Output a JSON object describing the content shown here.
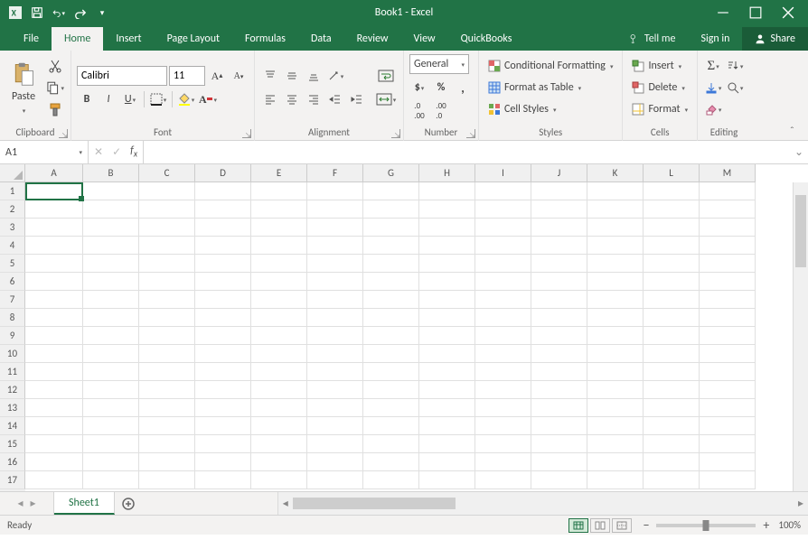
{
  "title": "Book1 - Excel",
  "qat": {
    "save": "save-icon",
    "undo": "undo-icon",
    "redo": "redo-icon"
  },
  "tabs": [
    "File",
    "Home",
    "Insert",
    "Page Layout",
    "Formulas",
    "Data",
    "Review",
    "View",
    "QuickBooks"
  ],
  "activeTab": "Home",
  "tellme": "Tell me",
  "signin": "Sign in",
  "share": "Share",
  "ribbon": {
    "clipboard": {
      "label": "Clipboard",
      "paste": "Paste"
    },
    "font": {
      "label": "Font",
      "name": "Calibri",
      "size": "11"
    },
    "alignment": {
      "label": "Alignment"
    },
    "number": {
      "label": "Number",
      "format": "General"
    },
    "styles": {
      "label": "Styles",
      "cond": "Conditional Formatting",
      "table": "Format as Table",
      "cell": "Cell Styles"
    },
    "cells": {
      "label": "Cells",
      "insert": "Insert",
      "delete": "Delete",
      "format": "Format"
    },
    "editing": {
      "label": "Editing"
    }
  },
  "namebox": "A1",
  "columns": [
    "A",
    "B",
    "C",
    "D",
    "E",
    "F",
    "G",
    "H",
    "I",
    "J",
    "K",
    "L",
    "M"
  ],
  "rows": 17,
  "sheet": "Sheet1",
  "status": "Ready",
  "zoom": "100%"
}
